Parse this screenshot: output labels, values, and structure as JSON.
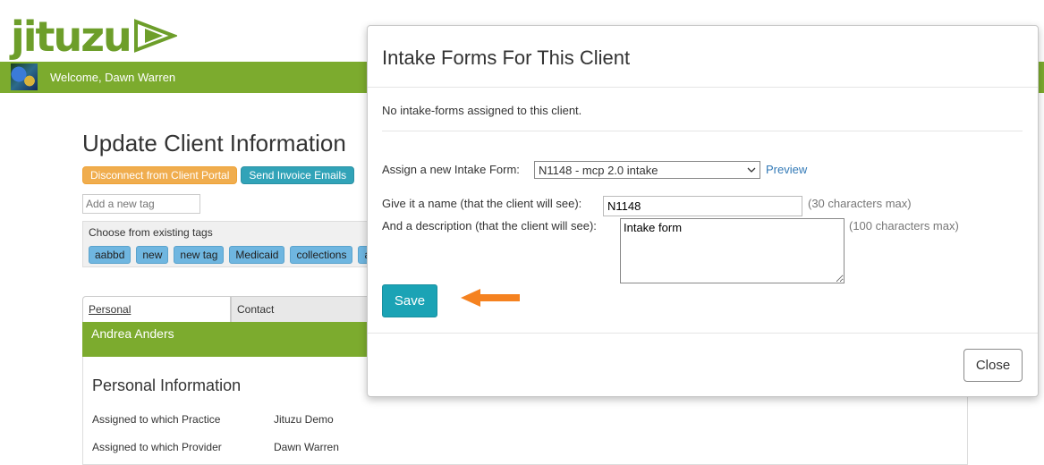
{
  "app": {
    "logo_text": "jituzu"
  },
  "header": {
    "welcome": "Welcome, Dawn Warren"
  },
  "page": {
    "title": "Update Client Information",
    "actions": {
      "disconnect": "Disconnect from Client Portal",
      "send_invoice": "Send Invoice Emails"
    },
    "tag_input_placeholder": "Add a new tag",
    "tags": {
      "caption": "Choose from existing tags",
      "items": [
        "aabbd",
        "new",
        "new tag",
        "Medicaid",
        "collections",
        "a"
      ]
    },
    "tabs": [
      "Personal",
      "Contact"
    ],
    "client_name": "Andrea Anders",
    "personal": {
      "title": "Personal Information",
      "rows": [
        {
          "label": "Assigned to which Practice",
          "value": "Jituzu Demo"
        },
        {
          "label": "Assigned to which Provider",
          "value": "Dawn Warren"
        }
      ]
    }
  },
  "modal": {
    "title": "Intake Forms For This Client",
    "no_forms": "No intake-forms assigned to this client.",
    "assign_label": "Assign a new Intake Form:",
    "selected_form": "N1148 - mcp 2.0 intake",
    "preview": "Preview",
    "name_label": "Give it a name (that the client will see):",
    "name_value": "N1148",
    "name_hint": "(30 characters max)",
    "desc_label": "And a description (that the client will see):",
    "desc_value": "Intake form",
    "desc_hint": "(100 characters max)",
    "save": "Save",
    "close": "Close"
  },
  "colors": {
    "brand_green": "#7cab2e",
    "teal": "#1ba3b5",
    "orange": "#f0ad4e",
    "arrow": "#f58220",
    "link": "#337ab7"
  },
  "icons": {
    "arrow": "left-arrow-icon",
    "select": "chevron-down-icon",
    "resize": "resize-grip-icon"
  }
}
